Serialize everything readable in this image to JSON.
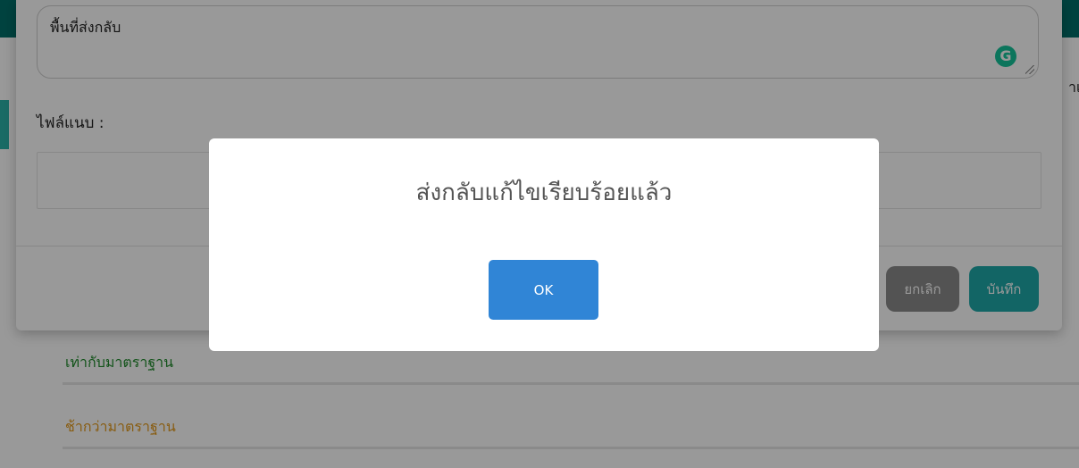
{
  "background_page": {
    "right_edge_text": "าเ",
    "status_labels": {
      "equal_standard": "เท่ากับมาตราฐาน",
      "slower_standard": "ช้ากว่ามาตราฐาน"
    }
  },
  "edit_modal": {
    "reply_field": {
      "value": "พื้นที่ส่งกลับ"
    },
    "grammarly_icon": "G",
    "attachment_label": "ไฟล์แนบ :",
    "buttons": {
      "cancel_label": "ยกเลิก",
      "save_label": "บันทึก"
    }
  },
  "alert_dialog": {
    "title": "ส่งกลับแก้ไขเรียบร้อยแล้ว",
    "ok_label": "OK"
  },
  "colors": {
    "header_teal": "#006f6a",
    "save_button": "#1fa8a8",
    "cancel_button": "#8a8a8a",
    "ok_button": "#3085d6",
    "status_green": "#1e8a2b",
    "status_orange": "#e39a1c"
  }
}
